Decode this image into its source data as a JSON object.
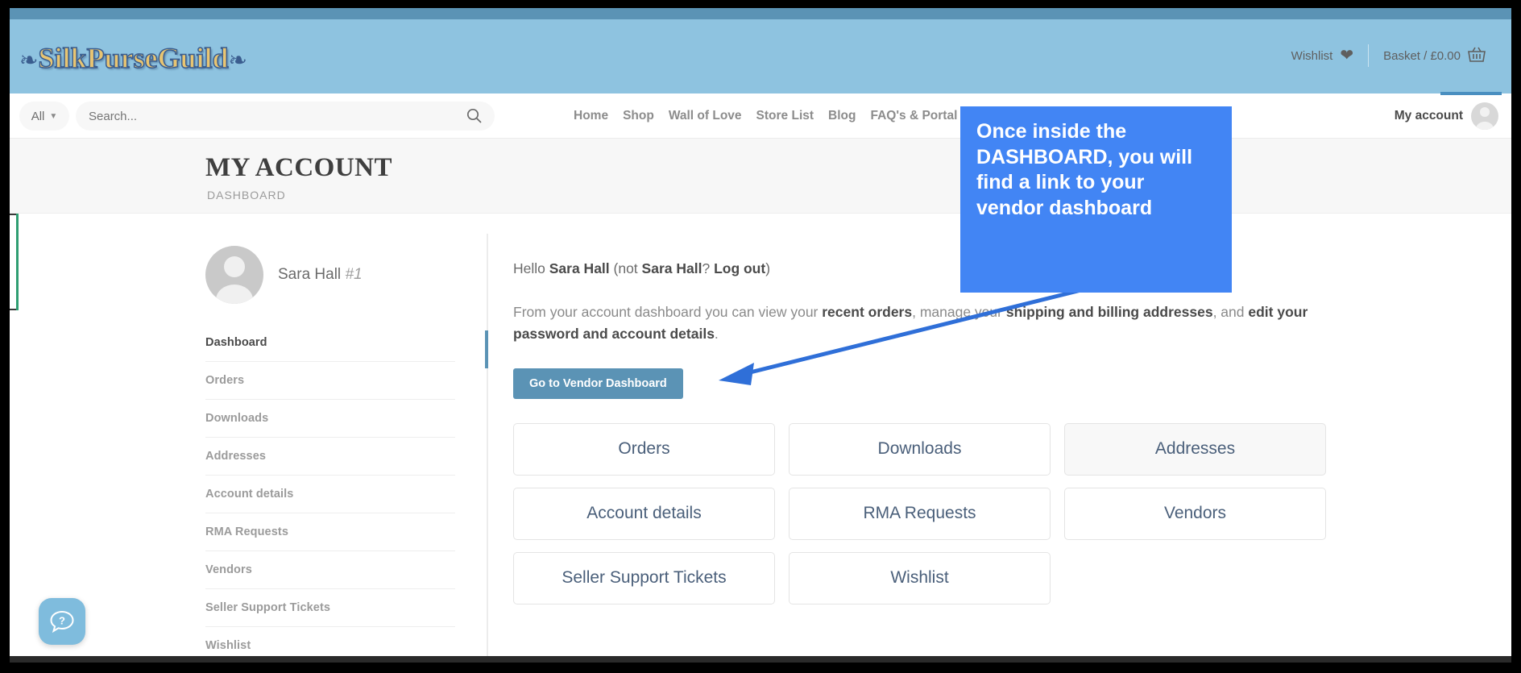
{
  "site": {
    "logo_text": "SilkPurseGuild",
    "logo_flourish_left": "❧",
    "logo_flourish_right": "❧"
  },
  "header": {
    "wishlist_label": "Wishlist",
    "wishlist_icon": "heart-icon",
    "basket_label": "Basket / £0.00",
    "basket_icon": "basket-icon"
  },
  "search": {
    "category_label": "All",
    "category_caret": "chevron-down-icon",
    "placeholder": "Search...",
    "value": "",
    "icon": "search-icon"
  },
  "nav": {
    "items": [
      {
        "label": "Home",
        "has_caret": false
      },
      {
        "label": "Shop",
        "has_caret": false
      },
      {
        "label": "Wall of Love",
        "has_caret": false
      },
      {
        "label": "Store List",
        "has_caret": false
      },
      {
        "label": "Blog",
        "has_caret": false
      },
      {
        "label": "FAQ's & Portal",
        "has_caret": true
      }
    ],
    "account_label": "My account",
    "account_icon": "avatar-icon"
  },
  "page": {
    "title": "MY ACCOUNT",
    "breadcrumb": "DASHBOARD"
  },
  "sidebar": {
    "user_name": "Sara Hall",
    "user_id": "#1",
    "items": [
      {
        "label": "Dashboard",
        "active": true
      },
      {
        "label": "Orders",
        "active": false
      },
      {
        "label": "Downloads",
        "active": false
      },
      {
        "label": "Addresses",
        "active": false
      },
      {
        "label": "Account details",
        "active": false
      },
      {
        "label": "RMA Requests",
        "active": false
      },
      {
        "label": "Vendors",
        "active": false
      },
      {
        "label": "Seller Support Tickets",
        "active": false
      },
      {
        "label": "Wishlist",
        "active": false
      }
    ]
  },
  "main": {
    "greeting_prefix": "Hello ",
    "greeting_name": "Sara Hall",
    "greeting_not": " (not ",
    "greeting_name2": "Sara Hall",
    "greeting_q": "? ",
    "logout_label": "Log out",
    "greeting_close": ")",
    "para_1": "From your account dashboard you can view your ",
    "para_link_1": "recent orders",
    "para_2": ", manage your ",
    "para_link_2": "shipping and billing addresses",
    "para_3": ", and ",
    "para_link_3": "edit your password and account details",
    "para_4": ".",
    "vendor_button": "Go to Vendor Dashboard",
    "tiles": [
      {
        "label": "Orders",
        "shaded": false
      },
      {
        "label": "Downloads",
        "shaded": false
      },
      {
        "label": "Addresses",
        "shaded": true
      },
      {
        "label": "Account details",
        "shaded": false
      },
      {
        "label": "RMA Requests",
        "shaded": false
      },
      {
        "label": "Vendors",
        "shaded": false
      },
      {
        "label": "Seller Support Tickets",
        "shaded": false
      },
      {
        "label": "Wishlist",
        "shaded": false
      }
    ]
  },
  "callout": {
    "text": "Once inside the DASHBOARD, you will find a link to your vendor dashboard",
    "color": "#4285f4"
  },
  "chat": {
    "icon": "question-chat-icon"
  },
  "colors": {
    "header_blue": "#8ec3e0",
    "strip_blue": "#5b93b5",
    "button_blue": "#5b93b5",
    "callout_blue": "#4285f4",
    "tile_text": "#4a5f7a"
  }
}
